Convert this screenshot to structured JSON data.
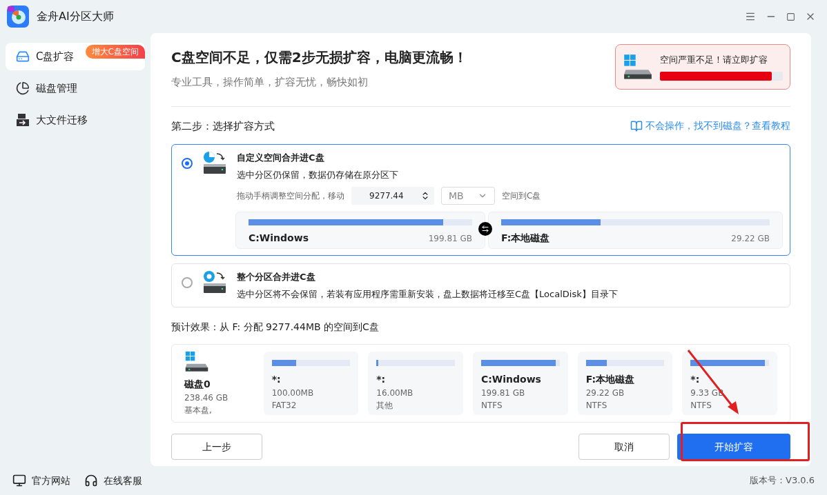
{
  "app": {
    "title": "金舟AI分区大师"
  },
  "sidebar": {
    "items": [
      {
        "label": "C盘扩容",
        "selected": true,
        "badge": "增大C盘空间",
        "kind": "drive"
      },
      {
        "label": "磁盘管理",
        "selected": false,
        "kind": "pie"
      },
      {
        "label": "大文件迁移",
        "selected": false,
        "kind": "move"
      }
    ]
  },
  "header": {
    "title": "C盘空间不足，仅需2步无损扩容，电脑更流畅！",
    "subtitle": "专业工具，操作简单，扩容无忧，畅快如初"
  },
  "alert": {
    "text": "空间严重不足！请立即扩容",
    "level": 0.91
  },
  "step": {
    "label": "第二步：选择扩容方式",
    "help_link": "不会操作，找不到磁盘？查看教程"
  },
  "options": [
    {
      "title": "自定义空间合并进C盘",
      "desc": "选中分区仍保留，数据仍存储在原分区下",
      "selected": true,
      "kind": "partial",
      "move_row": {
        "prefix": "拖动手柄调整空间分配，移动",
        "value": "9277.44",
        "unit": "MB",
        "suffix": "空间到C盘"
      },
      "partitions": [
        {
          "name": "C:Windows",
          "size": "199.81 GB",
          "level": 0.87
        },
        {
          "name": "F:本地磁盘",
          "size": "29.22 GB",
          "level": 0.37
        }
      ]
    },
    {
      "title": "整个分区合并进C盘",
      "desc": "选中分区将不会保留，若装有应用程序需重新安装，盘上数据将迁移至C盘【LocalDisk】目录下",
      "selected": false,
      "kind": "whole"
    }
  ],
  "preview": {
    "label": "预计效果：从 F: 分配 9277.44MB 的空间到C盘",
    "disk": {
      "name": "磁盘0",
      "size": "238.46 GB",
      "type": "基本盘,"
    },
    "partitions": [
      {
        "name": "*:",
        "size": "100.00MB",
        "fs": "FAT32",
        "level": 0.31
      },
      {
        "name": "*:",
        "size": "16.00MB",
        "fs": "其他",
        "level": 0.02
      },
      {
        "name": "C:Windows",
        "size": "199.81 GB",
        "fs": "NTFS",
        "level": 0.95
      },
      {
        "name": "F:本地磁盘",
        "size": "29.22 GB",
        "fs": "NTFS",
        "level": 0.27
      },
      {
        "name": "*:",
        "size": "9.33 GB",
        "fs": "NTFS",
        "level": 0.95
      }
    ]
  },
  "buttons": {
    "back": "上一步",
    "cancel": "取消",
    "start": "开始扩容"
  },
  "footer": {
    "links": [
      {
        "label": "官方网站",
        "kind": "monitor"
      },
      {
        "label": "在线客服",
        "kind": "headset"
      }
    ],
    "version": "版本号：V3.0.6"
  }
}
